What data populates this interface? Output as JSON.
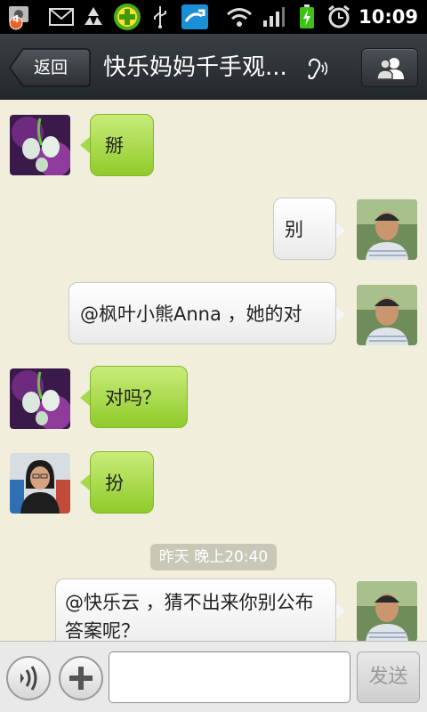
{
  "status_bar": {
    "notification_count": "4",
    "time": "10:09"
  },
  "header": {
    "back_label": "返回",
    "title": "快乐妈妈千手观..."
  },
  "messages": [
    {
      "side": "left",
      "avatar": "flower-avatar",
      "text": "掰"
    },
    {
      "side": "right",
      "avatar": "man-avatar",
      "text": "别"
    },
    {
      "side": "right",
      "avatar": "man-avatar",
      "text": "@枫叶小熊Anna ，她的对"
    },
    {
      "side": "left",
      "avatar": "flower-avatar",
      "text": "对吗？"
    },
    {
      "side": "left",
      "avatar": "girl-avatar",
      "text": "扮"
    },
    {
      "side": "right",
      "avatar": "man-avatar",
      "text": "@快乐云 ，猜不出来你别公布答案呢？"
    }
  ],
  "timestamp": "昨天 晚上20:40",
  "input": {
    "value": "",
    "send_label": "发送"
  },
  "colors": {
    "chat_background": "#f1eedb",
    "incoming_bubble": "#a6d94c",
    "outgoing_bubble": "#f6f6f6",
    "title_bar": "#2e3236"
  }
}
